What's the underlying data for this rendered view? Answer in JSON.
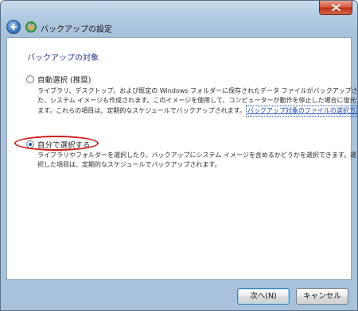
{
  "window": {
    "title": "バックアップの設定"
  },
  "content": {
    "heading": "バックアップの対象",
    "options": [
      {
        "label": "自動選択 (推奨)",
        "selected": false,
        "desc_lines": [
          "ライブラリ、デスクトップ、および既定の Windows フォルダーに保存されたデータ ファイルがバックアップされます。ま",
          "た、システム イメージも作成されます。このイメージを使用して、コンピューターが動作を停止した場合に復元でき",
          "ます。これらの項目は、定期的なスケジュールでバックアップされます。"
        ],
        "link": "バックアップ対象のファイルの選択方法"
      },
      {
        "label": "自分で選択する",
        "selected": true,
        "desc_lines": [
          "ライブラリやフォルダーを選択したり、バックアップにシステム イメージを含めるかどうかを選択できます。選",
          "択した項目は、定期的なスケジュールでバックアップされます。"
        ]
      }
    ]
  },
  "footer": {
    "next_label": "次へ(N)",
    "cancel_label": "キャンセル"
  },
  "colors": {
    "heading": "#1e3287",
    "link": "#1f4bb6",
    "annotation_ellipse": "#cc1f1a"
  },
  "icons": {
    "back": "back-arrow-icon",
    "app": "backup-icon",
    "close": "close-icon"
  }
}
